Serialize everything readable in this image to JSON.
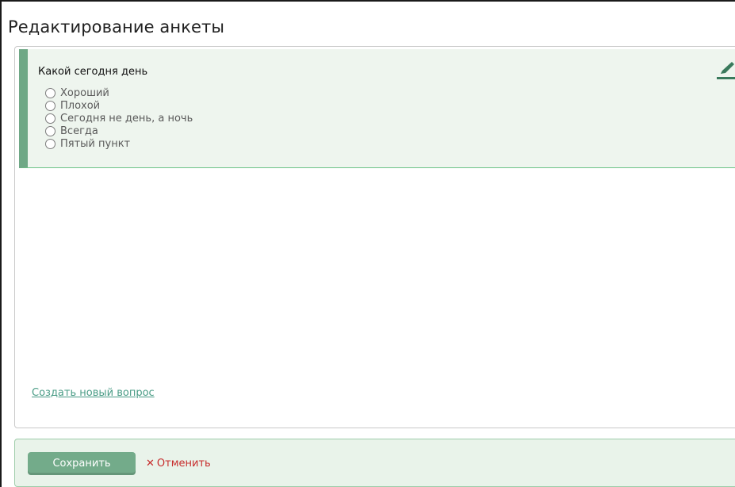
{
  "page": {
    "title": "Редактирование анкеты"
  },
  "question": {
    "title": "Какой сегодня день",
    "options": [
      {
        "label": "Хороший"
      },
      {
        "label": "Плохой"
      },
      {
        "label": "Сегодня не день, а ночь"
      },
      {
        "label": "Всегда"
      },
      {
        "label": "Пятый пункт"
      }
    ]
  },
  "links": {
    "create_question": "Создать новый вопрос"
  },
  "actions": {
    "save_label": "Сохранить",
    "cancel_icon": "✕",
    "cancel_label": "Отменить"
  },
  "colors": {
    "accent": "#6fa886",
    "card_bg": "#eef5ee",
    "save_button": "#73ab8a",
    "cancel": "#c72c2c",
    "link": "#4a9c86"
  },
  "icons": {
    "edit": "pencil-icon",
    "cancel": "close-icon"
  }
}
